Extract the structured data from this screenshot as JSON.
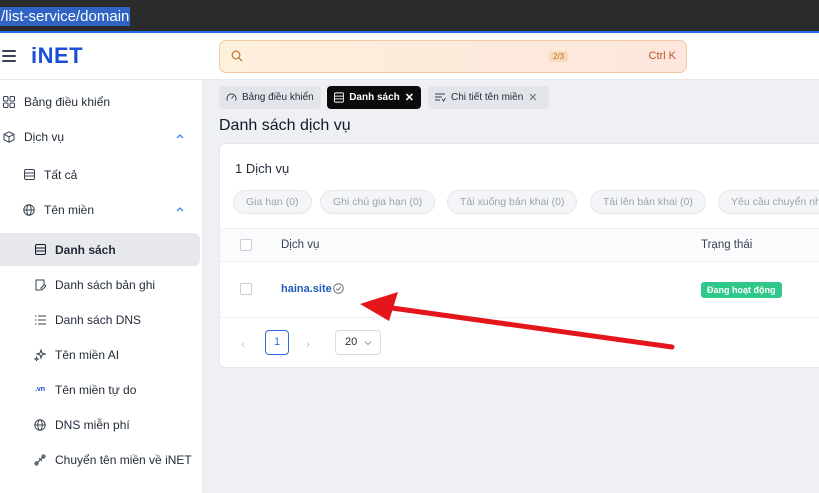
{
  "url": "/list-service/domain",
  "logo": {
    "text": "iNET"
  },
  "search": {
    "pager": "2/3",
    "shortcut": "Ctrl K"
  },
  "sidebar": {
    "items": [
      {
        "label": "Bảng điều khiển",
        "icon": "dashboard-icon"
      },
      {
        "label": "Dịch vụ",
        "icon": "cube-icon"
      },
      {
        "label": "Tất cả",
        "icon": "database-icon"
      },
      {
        "label": "Tên miền",
        "icon": "globe-icon"
      },
      {
        "label": "Danh sách",
        "icon": "database-icon"
      },
      {
        "label": "Danh sách bản ghi",
        "icon": "document-edit-icon"
      },
      {
        "label": "Danh sách DNS",
        "icon": "list-icon"
      },
      {
        "label": "Tên miền AI",
        "icon": "sparkles-icon"
      },
      {
        "label": "Tên miền tự do",
        "icon": "vn-icon",
        "icon_text": ".vn"
      },
      {
        "label": "DNS miễn phí",
        "icon": "globe-icon"
      },
      {
        "label": "Chuyển tên miền về iNET",
        "icon": "transfer-icon"
      }
    ]
  },
  "tabs": [
    {
      "label": "Bảng điều khiển"
    },
    {
      "label": "Danh sách"
    },
    {
      "label": "Chi tiết tên miền"
    }
  ],
  "page_title": "Danh sách dịch vụ",
  "card": {
    "count": "1 Dịch vụ",
    "filters": [
      "Gia hạn (0)",
      "Ghi chú gia hạn (0)",
      "Tải xuống bản khai (0)",
      "Tải lên bản khai (0)",
      "Yêu cầu chuyển nh"
    ],
    "columns": {
      "service": "Dịch vụ",
      "status": "Trạng thái"
    },
    "rows": [
      {
        "domain": "haina.site",
        "status": "Đang hoạt động"
      }
    ],
    "pagination": {
      "prev": "‹",
      "page": "1",
      "next": "›",
      "page_size": "20"
    }
  },
  "colors": {
    "brand": "#1c4fd8",
    "status_active": "#2ec98a",
    "arrow": "#e5161b"
  }
}
